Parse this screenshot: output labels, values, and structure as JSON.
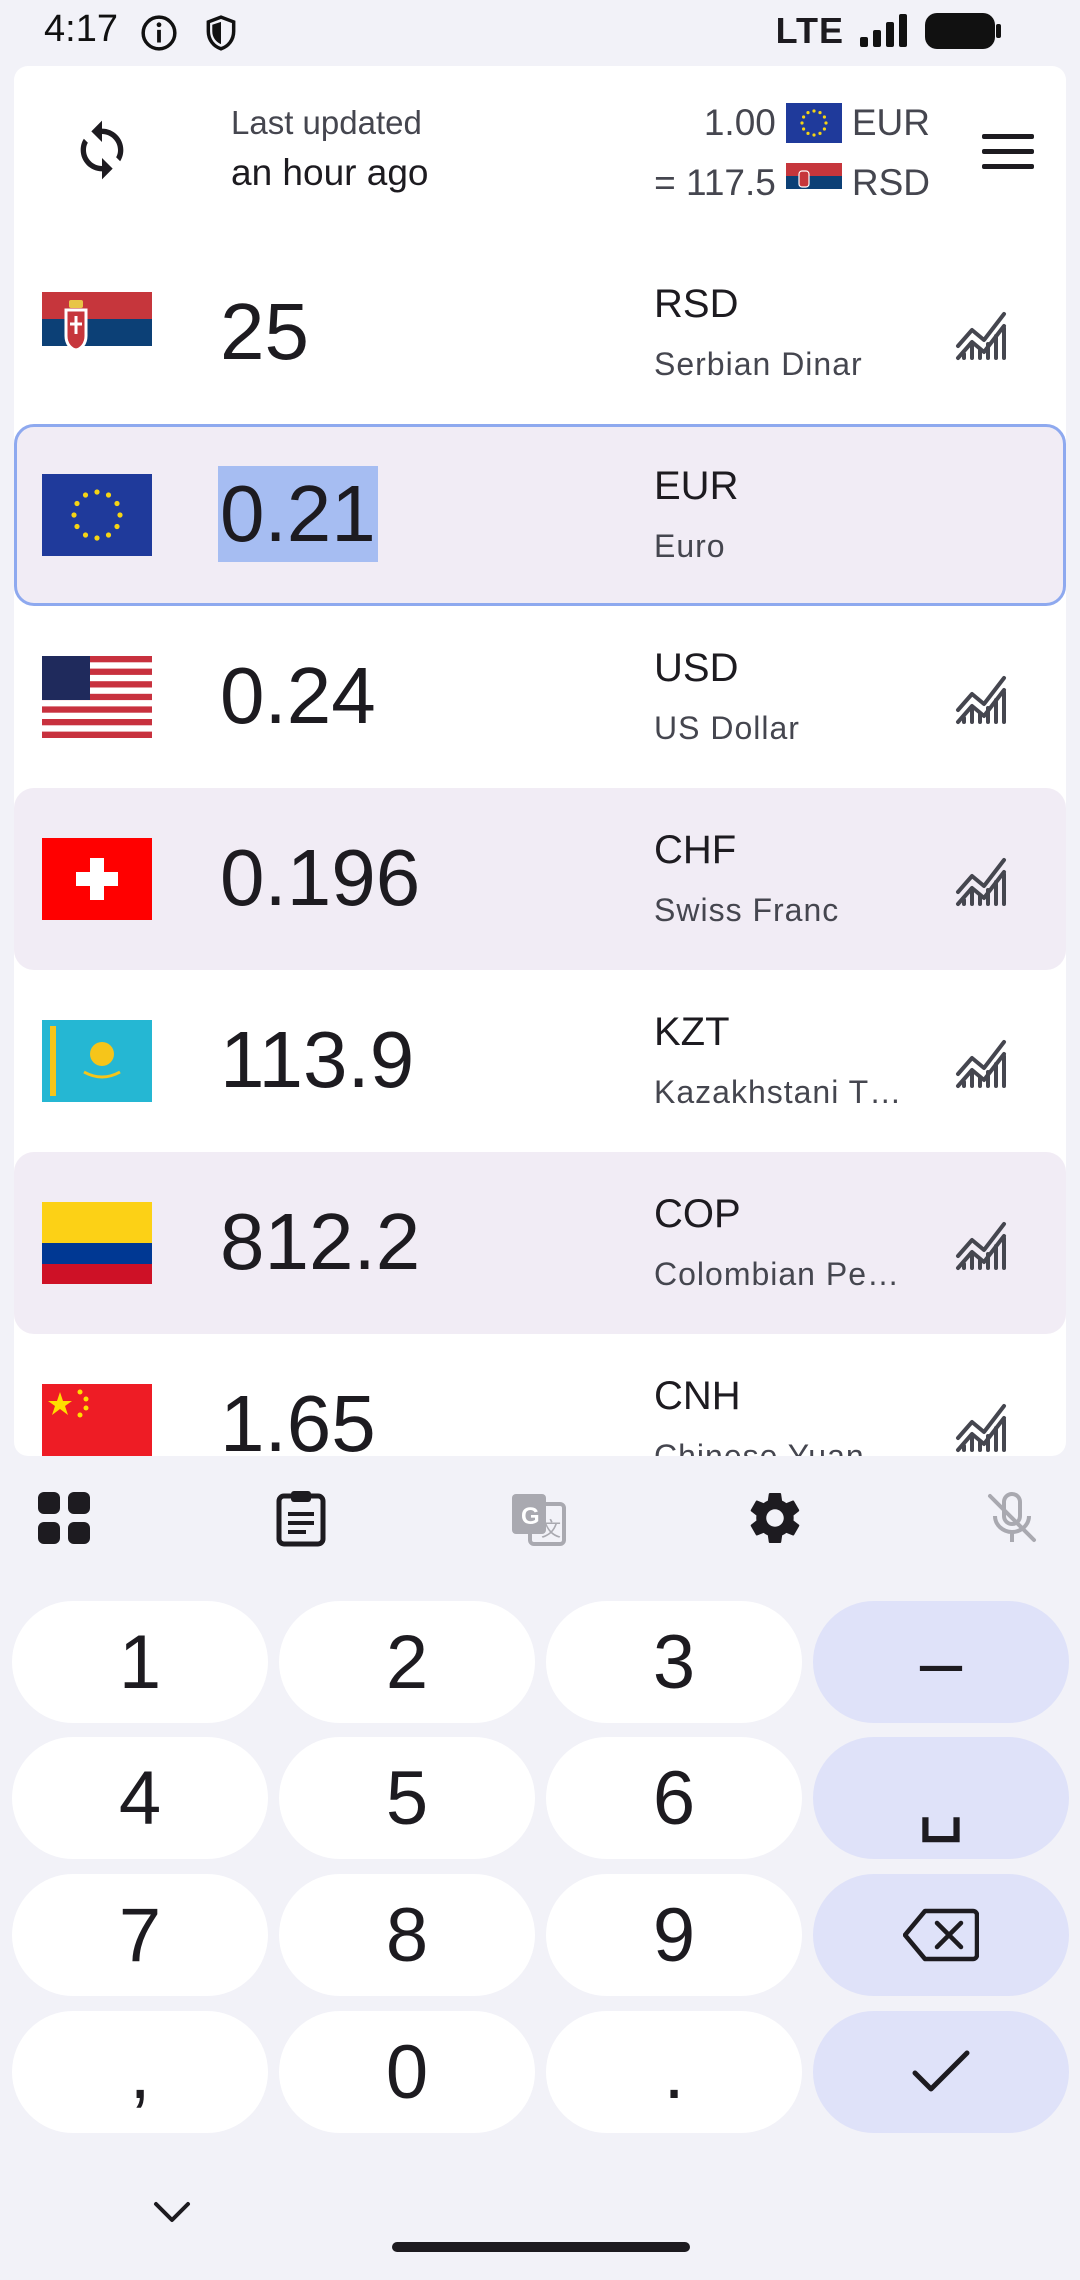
{
  "status_bar": {
    "time": "4:17",
    "network": "LTE"
  },
  "header": {
    "last_updated_label": "Last updated",
    "last_updated_value": "an hour ago",
    "base_amount": "1.00",
    "base_code": "EUR",
    "rate_prefix": "= 117.5",
    "target_code": "RSD"
  },
  "currencies": [
    {
      "code": "RSD",
      "name": "Serbian Dinar",
      "amount": "25",
      "flag": "serbia-flag-icon"
    },
    {
      "code": "EUR",
      "name": "Euro",
      "amount": "0.21",
      "flag": "eu-flag-icon",
      "selected": true
    },
    {
      "code": "USD",
      "name": "US Dollar",
      "amount": "0.24",
      "flag": "us-flag-icon"
    },
    {
      "code": "CHF",
      "name": "Swiss Franc",
      "amount": "0.196",
      "flag": "switzerland-flag-icon"
    },
    {
      "code": "KZT",
      "name": "Kazakhstani T…",
      "amount": "113.9",
      "flag": "kazakhstan-flag-icon"
    },
    {
      "code": "COP",
      "name": "Colombian Pe…",
      "amount": "812.2",
      "flag": "colombia-flag-icon"
    },
    {
      "code": "CNH",
      "name": "Chinese Yuan",
      "amount": "1.65",
      "flag": "china-flag-icon"
    }
  ],
  "toolbar": [
    "grid-icon",
    "clipboard-icon",
    "translate-icon",
    "settings-icon",
    "mic-off-icon"
  ],
  "keypad": {
    "k1": "1",
    "k2": "2",
    "k3": "3",
    "minus": "–",
    "k4": "4",
    "k5": "5",
    "k6": "6",
    "space": "␣",
    "k7": "7",
    "k8": "8",
    "k9": "9",
    "comma": ",",
    "k0": "0",
    "dot": "."
  },
  "colors": {
    "accent": "#8ea9ef",
    "highlight": "#a6bdf2",
    "row_tint": "#f1ecf5",
    "fn_key": "#dfe2f9"
  }
}
